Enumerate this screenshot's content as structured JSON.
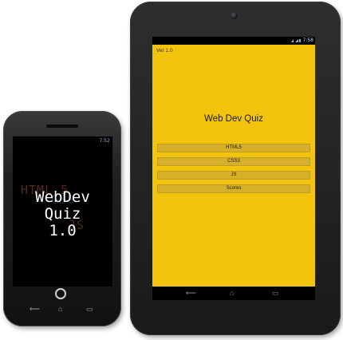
{
  "tablet": {
    "status_time": "7:58",
    "app": {
      "version": "Ver 1.0",
      "title": "Web Dev Quiz",
      "menu": [
        {
          "label": "HTML5"
        },
        {
          "label": "CSS3"
        },
        {
          "label": "JS"
        },
        {
          "label": "Scores"
        }
      ],
      "background_color": "#f2c40e",
      "button_color": "#d6b02a"
    },
    "nav": {
      "back": "⟵",
      "home": "⌂",
      "recents": "▭"
    }
  },
  "phone": {
    "status_time": "7:52",
    "splash": {
      "line1": "WebDev",
      "line2": "Quiz",
      "line3": "1.0",
      "bg_html": "HTML 5",
      "bg_css": "CSS",
      "bg_js": "JS"
    },
    "nav": {
      "back": "⟵",
      "home": "⌂",
      "recents": "▭"
    }
  }
}
